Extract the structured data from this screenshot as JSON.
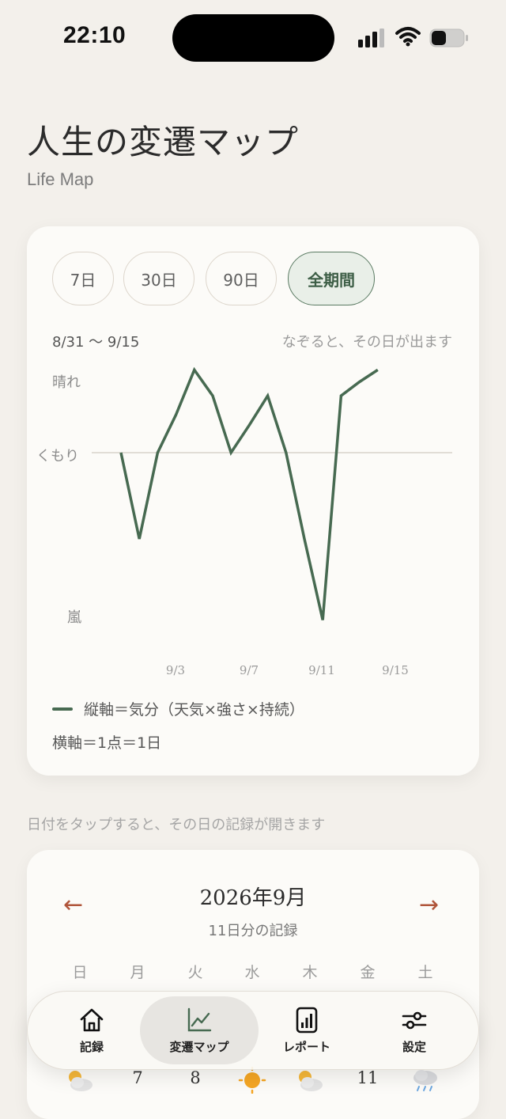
{
  "status": {
    "time": "22:10"
  },
  "header": {
    "title": "人生の変遷マップ",
    "subtitle": "Life Map"
  },
  "range_tabs": [
    {
      "label": "7日",
      "active": false
    },
    {
      "label": "30日",
      "active": false
    },
    {
      "label": "90日",
      "active": false
    },
    {
      "label": "全期間",
      "active": true
    }
  ],
  "chart_header": {
    "range": "8/31 〜 9/15",
    "hint": "なぞると、その日が出ます"
  },
  "chart_data": {
    "type": "line",
    "x": [
      "9/1",
      "9/2",
      "9/3",
      "9/4",
      "9/5",
      "9/6",
      "9/7",
      "9/8",
      "9/9",
      "9/10",
      "9/11",
      "9/12",
      "9/13",
      "9/14",
      "9/15"
    ],
    "series": [
      {
        "values": [
          0,
          -0.5,
          0,
          0.22,
          0.48,
          0.33,
          0,
          0.16,
          0.33,
          0,
          -0.5,
          -0.97,
          0.33,
          0.41,
          0.48
        ],
        "color": "#476a51"
      }
    ],
    "y_tick_labels": {
      "top": "晴れ",
      "middle": "くもり",
      "bottom": "嵐"
    },
    "x_tick_labels": [
      "9/3",
      "9/7",
      "9/11",
      "9/15"
    ],
    "ylim": [
      -1,
      0.5
    ],
    "baseline": 0
  },
  "legend": {
    "label": "縦軸＝気分（天気×強さ×持続）",
    "axis_note": "横軸＝1点＝1日"
  },
  "tap_note": "日付をタップすると、その日の記録が開きます",
  "calendar": {
    "month": "2026年9月",
    "count": "11日分の記録",
    "prev_icon": "←",
    "next_icon": "→",
    "weekdays": [
      "日",
      "月",
      "火",
      "水",
      "木",
      "金",
      "土"
    ],
    "visible_cells": [
      "partly-cloudy-icon",
      "7",
      "8",
      "sun-icon",
      "partly-cloudy-icon",
      "11",
      "rain-cloud-icon"
    ]
  },
  "tabbar": [
    {
      "label": "記録",
      "icon": "home-icon",
      "active": false
    },
    {
      "label": "変遷マップ",
      "icon": "line-chart-icon",
      "active": true
    },
    {
      "label": "レポート",
      "icon": "report-icon",
      "active": false
    },
    {
      "label": "設定",
      "icon": "sliders-icon",
      "active": false
    }
  ],
  "colors": {
    "accent": "#476a51",
    "arrow": "#b0553a",
    "background": "#f3f0eb"
  }
}
